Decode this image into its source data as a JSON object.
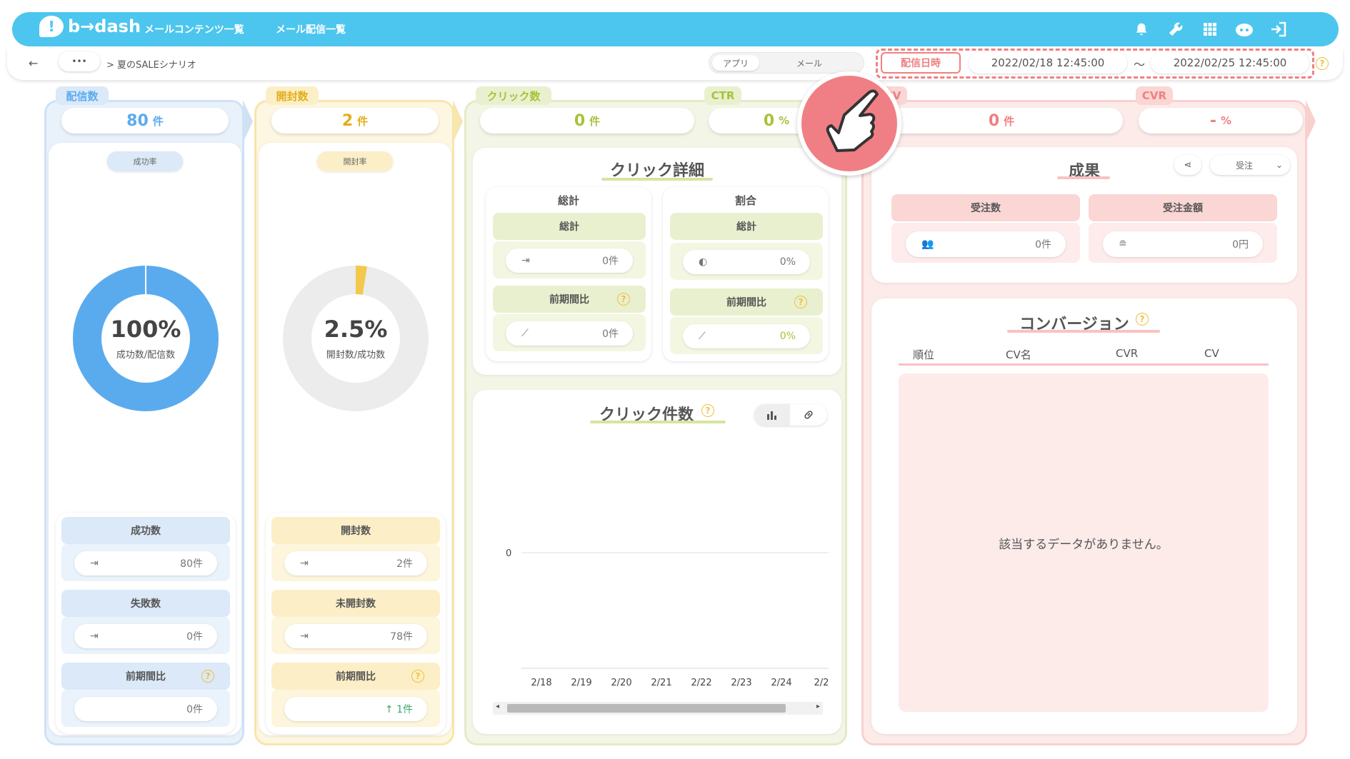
{
  "header": {
    "logo_text": "b→dash",
    "nav": [
      "メールコンテンツ一覧",
      "メール配信一覧"
    ],
    "icons": [
      "bell-icon",
      "wrench-icon",
      "grid-icon",
      "robot-icon",
      "logout-icon"
    ]
  },
  "subbar": {
    "back": "←",
    "dots": "•••",
    "breadcrumb": "> 夏のSALEシナリオ",
    "toggle": {
      "app": "アプリ",
      "mail": "メール"
    },
    "date_label": "配信日時",
    "date_from": "2022/02/18 12:45:00",
    "tilde": "〜",
    "date_to": "2022/02/25 12:45:00"
  },
  "sent": {
    "title": "配信数",
    "value": "80",
    "unit": "件",
    "rate_label": "成功率",
    "ring_value": "100%",
    "ring_sub": "成功数/配信数",
    "ring_fraction": 1.0,
    "stats": [
      {
        "label": "成功数",
        "value": "80件"
      },
      {
        "label": "失敗数",
        "value": "0件"
      },
      {
        "label": "前期間比",
        "value": "0件"
      }
    ]
  },
  "open": {
    "title": "開封数",
    "value": "2",
    "unit": "件",
    "rate_label": "開封率",
    "ring_value": "2.5%",
    "ring_sub": "開封数/成功数",
    "ring_fraction": 0.025,
    "stats": [
      {
        "label": "開封数",
        "value": "2件"
      },
      {
        "label": "未開封数",
        "value": "78件"
      },
      {
        "label": "前期間比",
        "value": "↑ 1件"
      }
    ]
  },
  "click": {
    "title": "クリック数",
    "value": "0",
    "unit": "件",
    "ctr_title": "CTR",
    "ctr_value": "0",
    "ctr_unit": "%",
    "detail_title": "クリック詳細",
    "total_title": "総計",
    "ratio_title": "割合",
    "sub_total": "総計",
    "sub_prev": "前期間比",
    "total_value": "0件",
    "total_prev": "0件",
    "ratio_value": "0%",
    "ratio_prev": "0%",
    "count_title": "クリック件数"
  },
  "chart_data": {
    "type": "bar",
    "title": "クリック件数",
    "categories": [
      "2/18",
      "2/19",
      "2/20",
      "2/21",
      "2/22",
      "2/23",
      "2/24",
      "2/2"
    ],
    "values": [
      0,
      0,
      0,
      0,
      0,
      0,
      0,
      0
    ],
    "y_ticks": [
      "0"
    ],
    "ylim": [
      0,
      0
    ]
  },
  "cv": {
    "title": "CV",
    "value": "0",
    "unit": "件",
    "cvr_title": "CVR",
    "cvr_value": "-",
    "cvr_unit": "%",
    "result_title": "成果",
    "result_select": "受注",
    "orders_label": "受注数",
    "orders_value": "0件",
    "amount_label": "受注金額",
    "amount_value": "0円",
    "conv_title": "コンバージョン",
    "table_headers": [
      "順位",
      "CV名",
      "CVR",
      "CV"
    ],
    "empty_text": "該当するデータがありません。"
  },
  "colors": {
    "blue": "#4cc6ee",
    "sent": "#5aabee",
    "open": "#f2c94c",
    "click": "#a8c23a",
    "cv": "#f08080"
  }
}
